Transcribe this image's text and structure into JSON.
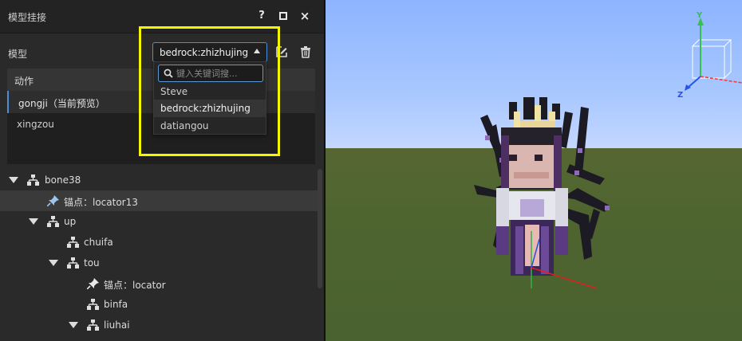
{
  "panel": {
    "title": "模型挂接",
    "help_label": "?",
    "close_label": "×",
    "model_label": "模型",
    "model_value": "bedrock:zhizhujing"
  },
  "actions": {
    "header": "动作",
    "items": [
      {
        "label": "gongji（当前预览）"
      },
      {
        "label": "xingzou"
      }
    ]
  },
  "dropdown": {
    "search_placeholder": "键入关键词搜...",
    "options": [
      {
        "label": "Steve"
      },
      {
        "label": "bedrock:zhizhujing"
      },
      {
        "label": "datiangou"
      }
    ]
  },
  "tree": {
    "nodes": [
      {
        "label": "bone38"
      },
      {
        "label": "锚点：locator13"
      },
      {
        "label": "up"
      },
      {
        "label": "chuifa"
      },
      {
        "label": "tou"
      },
      {
        "label": "锚点：locator"
      },
      {
        "label": "binfa"
      },
      {
        "label": "liuhai"
      }
    ]
  },
  "viewport": {
    "gizmo": {
      "y_label": "Y",
      "z_label": "Z"
    }
  },
  "colors": {
    "accent": "#4a8fd8",
    "highlight": "#f5f500",
    "panel_bg": "#2a2a2a",
    "sky": "#a9c8ff",
    "grass": "#4f6530"
  }
}
